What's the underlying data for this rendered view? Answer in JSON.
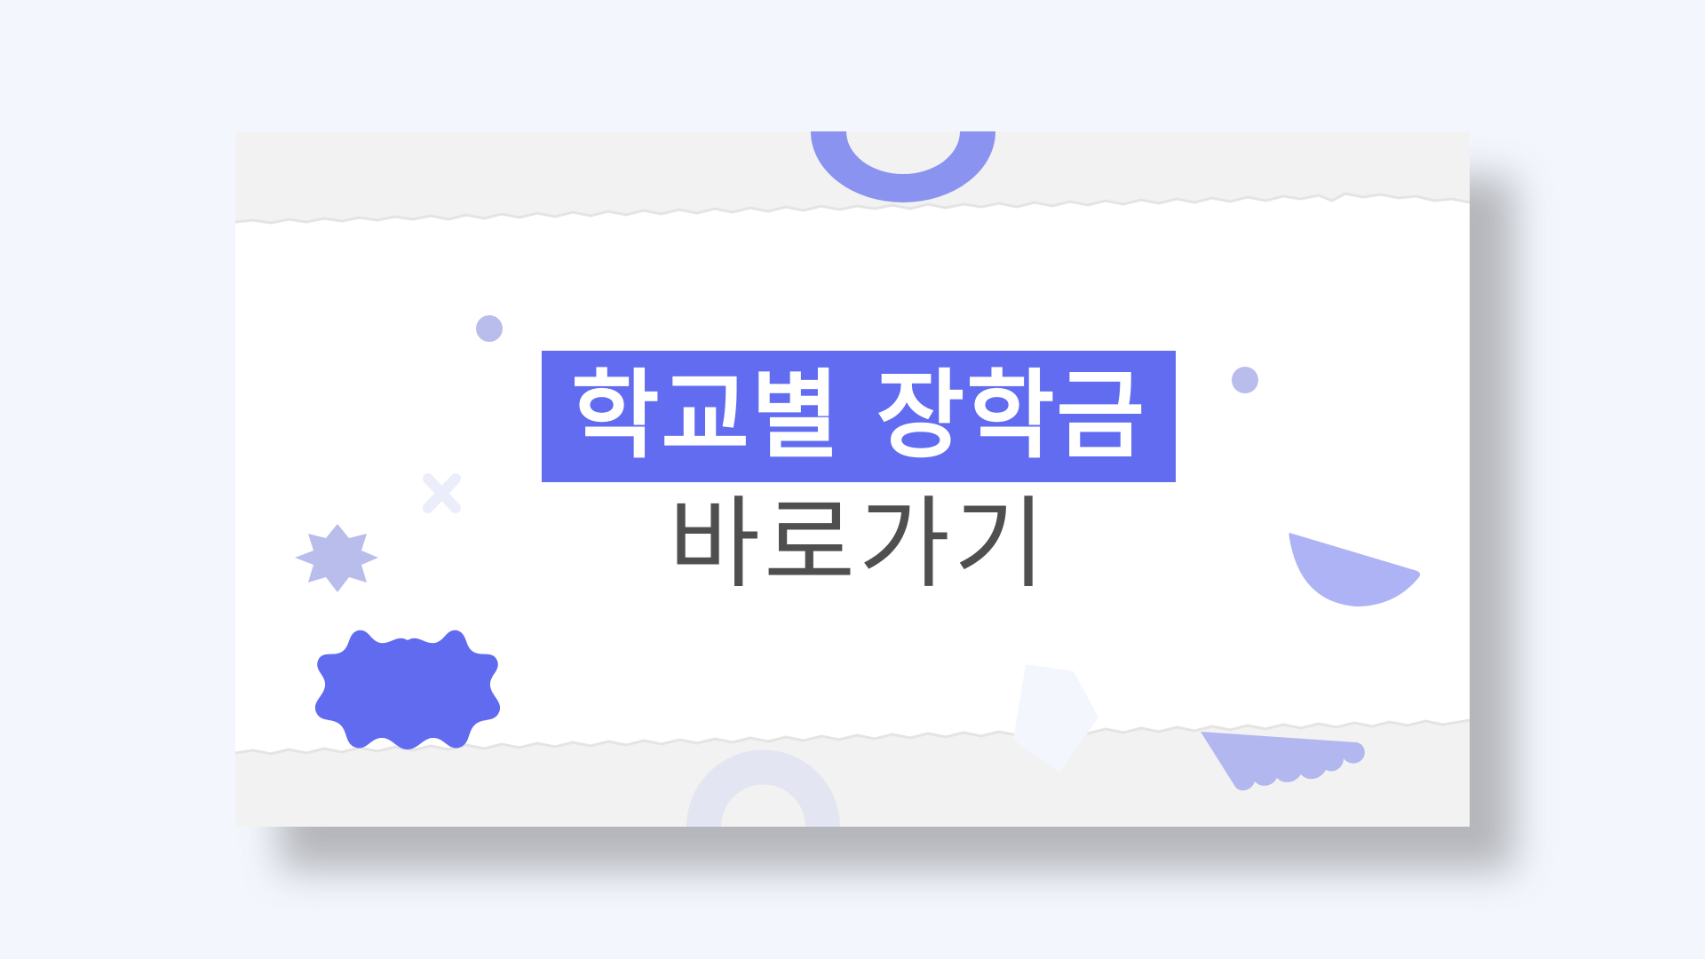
{
  "banner": {
    "title": "학교별 장학금",
    "subtitle": "바로가기"
  },
  "colors": {
    "page_background": "#f3f6fd",
    "accent": "#616cf0",
    "accent_light": "#b9bdec",
    "card": "#ffffff",
    "torn_band": "#f2f2f2",
    "subtitle_text": "#4f4f4f"
  },
  "decorations": [
    "half-ring-top",
    "dot-left",
    "dot-right",
    "starburst",
    "cross",
    "wavy-badge",
    "half-circle-right",
    "diamond",
    "half-ring-bottom",
    "scalloped-shape"
  ]
}
